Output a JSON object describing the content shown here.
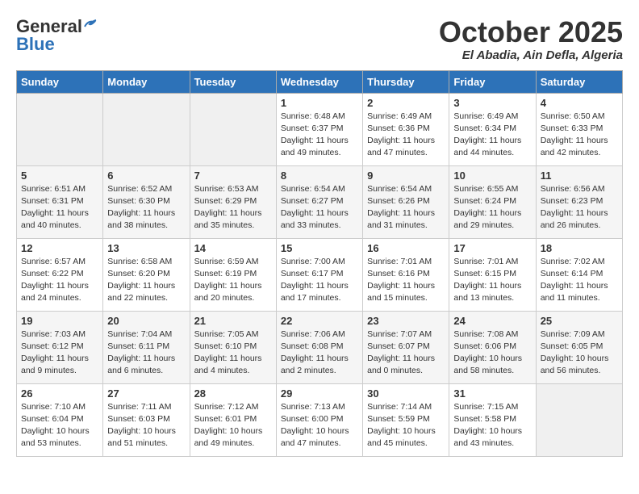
{
  "header": {
    "logo_general": "General",
    "logo_blue": "Blue",
    "month": "October 2025",
    "location": "El Abadia, Ain Defla, Algeria"
  },
  "days_of_week": [
    "Sunday",
    "Monday",
    "Tuesday",
    "Wednesday",
    "Thursday",
    "Friday",
    "Saturday"
  ],
  "weeks": [
    [
      {
        "day": "",
        "info": ""
      },
      {
        "day": "",
        "info": ""
      },
      {
        "day": "",
        "info": ""
      },
      {
        "day": "1",
        "info": "Sunrise: 6:48 AM\nSunset: 6:37 PM\nDaylight: 11 hours\nand 49 minutes."
      },
      {
        "day": "2",
        "info": "Sunrise: 6:49 AM\nSunset: 6:36 PM\nDaylight: 11 hours\nand 47 minutes."
      },
      {
        "day": "3",
        "info": "Sunrise: 6:49 AM\nSunset: 6:34 PM\nDaylight: 11 hours\nand 44 minutes."
      },
      {
        "day": "4",
        "info": "Sunrise: 6:50 AM\nSunset: 6:33 PM\nDaylight: 11 hours\nand 42 minutes."
      }
    ],
    [
      {
        "day": "5",
        "info": "Sunrise: 6:51 AM\nSunset: 6:31 PM\nDaylight: 11 hours\nand 40 minutes."
      },
      {
        "day": "6",
        "info": "Sunrise: 6:52 AM\nSunset: 6:30 PM\nDaylight: 11 hours\nand 38 minutes."
      },
      {
        "day": "7",
        "info": "Sunrise: 6:53 AM\nSunset: 6:29 PM\nDaylight: 11 hours\nand 35 minutes."
      },
      {
        "day": "8",
        "info": "Sunrise: 6:54 AM\nSunset: 6:27 PM\nDaylight: 11 hours\nand 33 minutes."
      },
      {
        "day": "9",
        "info": "Sunrise: 6:54 AM\nSunset: 6:26 PM\nDaylight: 11 hours\nand 31 minutes."
      },
      {
        "day": "10",
        "info": "Sunrise: 6:55 AM\nSunset: 6:24 PM\nDaylight: 11 hours\nand 29 minutes."
      },
      {
        "day": "11",
        "info": "Sunrise: 6:56 AM\nSunset: 6:23 PM\nDaylight: 11 hours\nand 26 minutes."
      }
    ],
    [
      {
        "day": "12",
        "info": "Sunrise: 6:57 AM\nSunset: 6:22 PM\nDaylight: 11 hours\nand 24 minutes."
      },
      {
        "day": "13",
        "info": "Sunrise: 6:58 AM\nSunset: 6:20 PM\nDaylight: 11 hours\nand 22 minutes."
      },
      {
        "day": "14",
        "info": "Sunrise: 6:59 AM\nSunset: 6:19 PM\nDaylight: 11 hours\nand 20 minutes."
      },
      {
        "day": "15",
        "info": "Sunrise: 7:00 AM\nSunset: 6:17 PM\nDaylight: 11 hours\nand 17 minutes."
      },
      {
        "day": "16",
        "info": "Sunrise: 7:01 AM\nSunset: 6:16 PM\nDaylight: 11 hours\nand 15 minutes."
      },
      {
        "day": "17",
        "info": "Sunrise: 7:01 AM\nSunset: 6:15 PM\nDaylight: 11 hours\nand 13 minutes."
      },
      {
        "day": "18",
        "info": "Sunrise: 7:02 AM\nSunset: 6:14 PM\nDaylight: 11 hours\nand 11 minutes."
      }
    ],
    [
      {
        "day": "19",
        "info": "Sunrise: 7:03 AM\nSunset: 6:12 PM\nDaylight: 11 hours\nand 9 minutes."
      },
      {
        "day": "20",
        "info": "Sunrise: 7:04 AM\nSunset: 6:11 PM\nDaylight: 11 hours\nand 6 minutes."
      },
      {
        "day": "21",
        "info": "Sunrise: 7:05 AM\nSunset: 6:10 PM\nDaylight: 11 hours\nand 4 minutes."
      },
      {
        "day": "22",
        "info": "Sunrise: 7:06 AM\nSunset: 6:08 PM\nDaylight: 11 hours\nand 2 minutes."
      },
      {
        "day": "23",
        "info": "Sunrise: 7:07 AM\nSunset: 6:07 PM\nDaylight: 11 hours\nand 0 minutes."
      },
      {
        "day": "24",
        "info": "Sunrise: 7:08 AM\nSunset: 6:06 PM\nDaylight: 10 hours\nand 58 minutes."
      },
      {
        "day": "25",
        "info": "Sunrise: 7:09 AM\nSunset: 6:05 PM\nDaylight: 10 hours\nand 56 minutes."
      }
    ],
    [
      {
        "day": "26",
        "info": "Sunrise: 7:10 AM\nSunset: 6:04 PM\nDaylight: 10 hours\nand 53 minutes."
      },
      {
        "day": "27",
        "info": "Sunrise: 7:11 AM\nSunset: 6:03 PM\nDaylight: 10 hours\nand 51 minutes."
      },
      {
        "day": "28",
        "info": "Sunrise: 7:12 AM\nSunset: 6:01 PM\nDaylight: 10 hours\nand 49 minutes."
      },
      {
        "day": "29",
        "info": "Sunrise: 7:13 AM\nSunset: 6:00 PM\nDaylight: 10 hours\nand 47 minutes."
      },
      {
        "day": "30",
        "info": "Sunrise: 7:14 AM\nSunset: 5:59 PM\nDaylight: 10 hours\nand 45 minutes."
      },
      {
        "day": "31",
        "info": "Sunrise: 7:15 AM\nSunset: 5:58 PM\nDaylight: 10 hours\nand 43 minutes."
      },
      {
        "day": "",
        "info": ""
      }
    ]
  ]
}
